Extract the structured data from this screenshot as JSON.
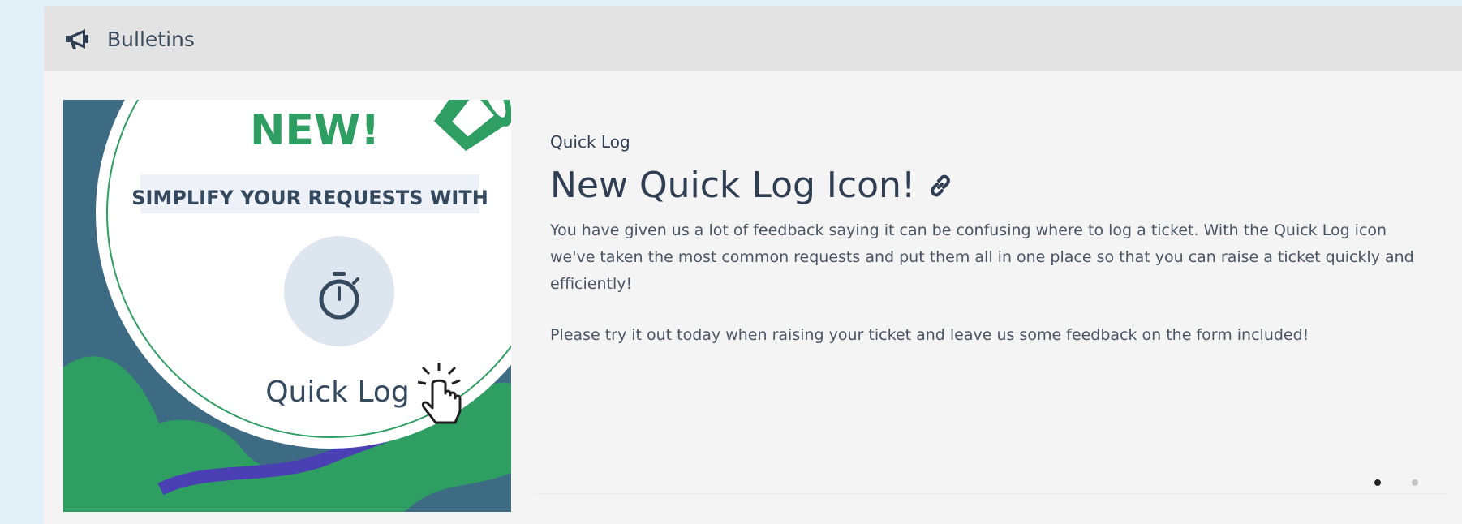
{
  "panel": {
    "title": "Bulletins",
    "icon": "megaphone-icon"
  },
  "banner": {
    "new_label": "NEW!",
    "tagline": "SIMPLIFY YOUR REQUESTS WITH",
    "product_label": "Quick Log",
    "colors": {
      "teal": "#3d6b84",
      "green": "#2f9e63",
      "purple": "#4b3fb4",
      "stopwatch_circle": "#dde5ef",
      "stopwatch": "#354a5f"
    }
  },
  "bulletin": {
    "category": "Quick Log",
    "title": "New Quick Log Icon!",
    "paragraphs": [
      "You have given us a lot of feedback saying it can be confusing where to log a ticket. With the Quick Log icon we've taken the most common requests and put them all in one place so that you can raise a ticket quickly and efficiently!",
      "Please try it out today when raising your ticket and leave us some feedback on the form included!"
    ]
  },
  "carousel": {
    "count": 2,
    "active_index": 0
  }
}
